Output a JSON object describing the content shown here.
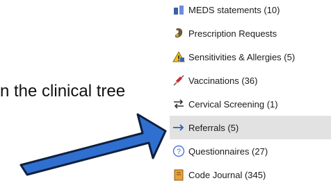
{
  "caption": "n the clinical tree",
  "tree": {
    "items": [
      {
        "label": "MEDS statements (10)",
        "icon": "medication-statement-icon"
      },
      {
        "label": "Prescription Requests",
        "icon": "prescription-request-icon"
      },
      {
        "label": "Sensitivities & Allergies (5)",
        "icon": "allergy-warning-icon"
      },
      {
        "label": "Vaccinations (36)",
        "icon": "syringe-icon"
      },
      {
        "label": "Cervical Screening (1)",
        "icon": "screening-arrows-icon"
      },
      {
        "label": "Referrals (5)",
        "icon": "right-arrow-icon",
        "selected": true
      },
      {
        "label": "Questionnaires (27)",
        "icon": "question-mark-icon"
      },
      {
        "label": "Code Journal (345)",
        "icon": "journal-icon"
      }
    ]
  },
  "annotation": {
    "icon": "pointer-arrow-icon",
    "color": "#2f6fcf"
  }
}
